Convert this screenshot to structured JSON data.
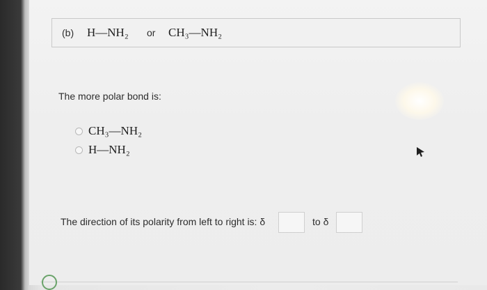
{
  "question": {
    "label": "(b)",
    "formula_left": "H—NH₂",
    "or_text": "or",
    "formula_right": "CH₃—NH₂"
  },
  "prompt": "The more polar bond is:",
  "options": [
    {
      "label": "CH₃—NH₂",
      "selected": false
    },
    {
      "label": "H—NH₂",
      "selected": false
    }
  ],
  "direction": {
    "text": "The direction of its polarity from left to right is: δ",
    "to_text": "to δ",
    "first_value": "",
    "second_value": ""
  }
}
